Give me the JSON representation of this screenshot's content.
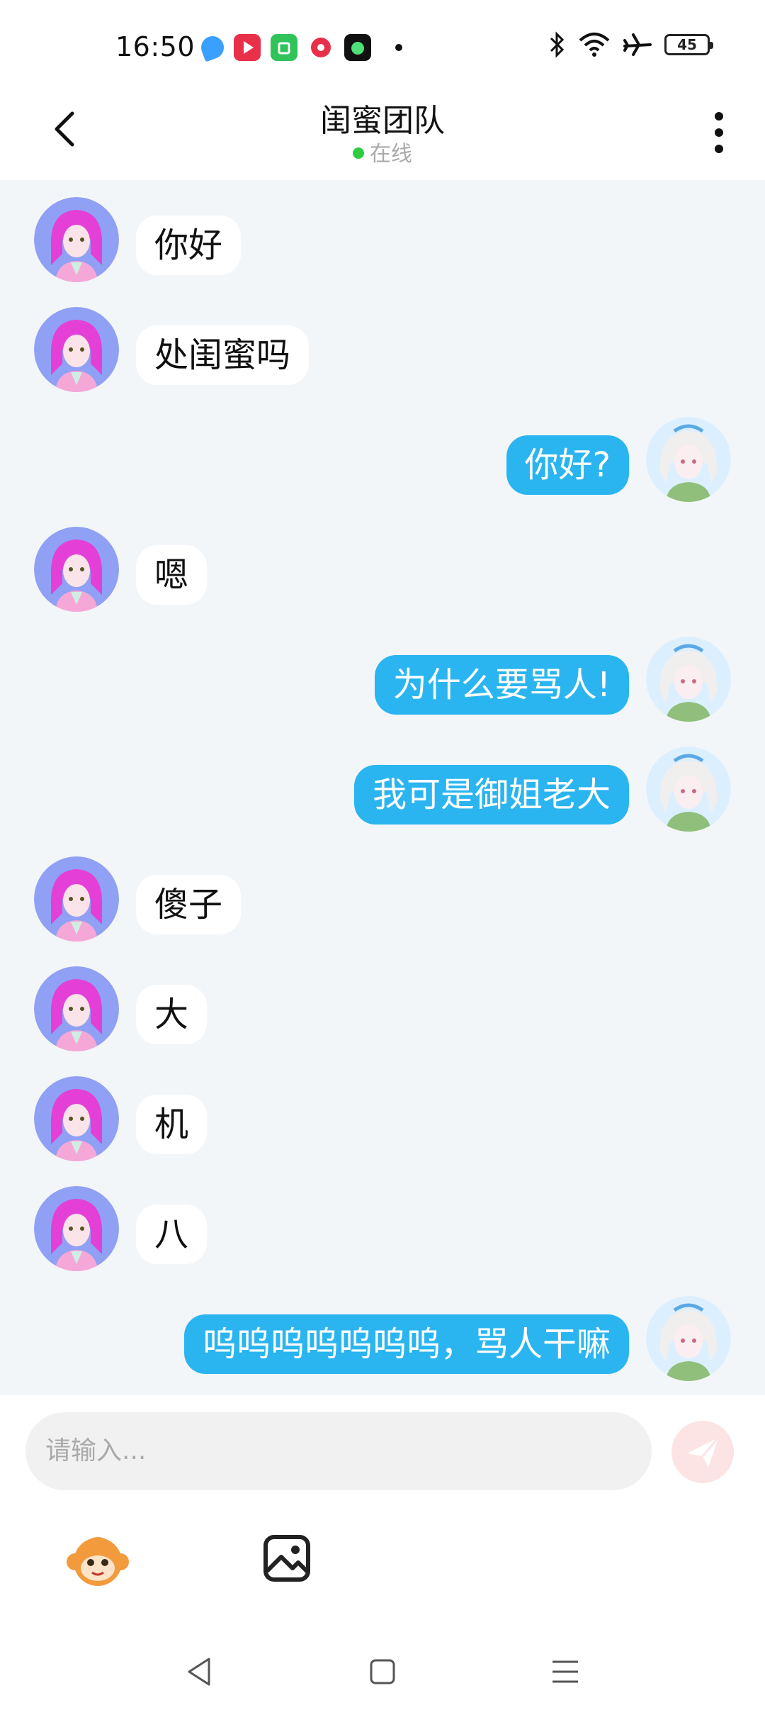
{
  "status_bar": {
    "time": "16:50",
    "battery": "45"
  },
  "header": {
    "title": "闺蜜团队",
    "status": "在线"
  },
  "messages": [
    {
      "side": "left",
      "text": "你好"
    },
    {
      "side": "left",
      "text": "处闺蜜吗"
    },
    {
      "side": "right",
      "text": "你好?"
    },
    {
      "side": "left",
      "text": "嗯"
    },
    {
      "side": "right",
      "text": "为什么要骂人!"
    },
    {
      "side": "right",
      "text": "我可是御姐老大"
    },
    {
      "side": "left",
      "text": "傻子"
    },
    {
      "side": "left",
      "text": "大"
    },
    {
      "side": "left",
      "text": "机"
    },
    {
      "side": "left",
      "text": "八"
    },
    {
      "side": "right",
      "text": "呜呜呜呜呜呜呜，骂人干嘛"
    }
  ],
  "composer": {
    "placeholder": "请输入..."
  },
  "colors": {
    "accent": "#2bb5f0",
    "chat_bg": "#f3f6f9",
    "online": "#2ecc40"
  },
  "icons": {
    "back": "chevron-left-icon",
    "more": "more-vertical-icon",
    "send": "send-icon",
    "mascot": "monkey-mascot-icon",
    "image": "image-icon",
    "nav_back": "nav-back-icon",
    "nav_home": "nav-home-icon",
    "nav_menu": "nav-menu-icon"
  }
}
